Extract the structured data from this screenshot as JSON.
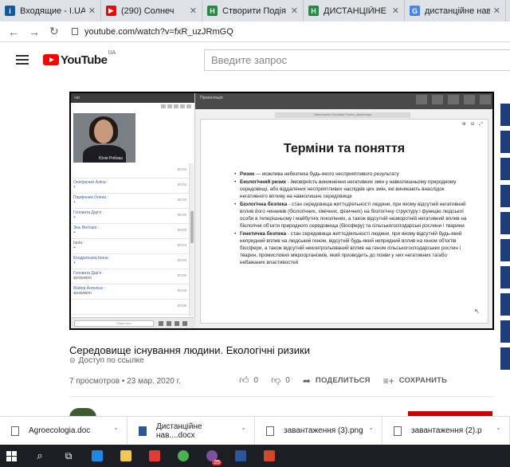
{
  "browser": {
    "tabs": [
      {
        "label": "Входящие - I.UA",
        "icon": "mail-icon",
        "color": "#0b5ba8",
        "glyph": "i"
      },
      {
        "label": "(290) Солнеч",
        "icon": "youtube-icon",
        "color": "#ff0000",
        "glyph": "▶"
      },
      {
        "label": "Створити Подія",
        "icon": "shield-icon",
        "color": "#1e8e3e",
        "glyph": "H"
      },
      {
        "label": "ДИСТАНЦІЙНЕ Н",
        "icon": "shield-icon",
        "color": "#1e8e3e",
        "glyph": "H"
      },
      {
        "label": "дистанційне нав",
        "icon": "google-icon",
        "color": "#4285f4",
        "glyph": "G"
      }
    ],
    "url": "youtube.com/watch?v=fxR_uzJRmGQ"
  },
  "youtube": {
    "logo_text": "YouTube",
    "region": "UA",
    "search_placeholder": "Введите запрос"
  },
  "conference": {
    "left_header": "чат",
    "presenter_name": "Юлія Рябова",
    "messages": [
      {
        "who": "",
        "body": "",
        "time": "00:03"
      },
      {
        "who": "Онопрієнко Аліна :",
        "body": "+",
        "time": "00:03"
      },
      {
        "who": "Парфенюк Олена :",
        "body": "+",
        "time": "00:03"
      },
      {
        "who": "Головата Дар'я :",
        "body": "+",
        "time": "00:03"
      },
      {
        "who": "Зінь Вікторія :",
        "body": "+",
        "time": "00:03"
      },
      {
        "who": "Ianta :",
        "body": "+",
        "time": "00:04"
      },
      {
        "who": "Кондратьєва Ірина :",
        "body": "+",
        "time": "00:04"
      },
      {
        "who": "Головата Дар'я :",
        "body": "зрозуміло",
        "time": "00:06"
      },
      {
        "who": "Майор Ангеліна :",
        "body": "зрозуміло",
        "time": "00:09"
      },
      {
        "who": "",
        "body": "",
        "time": "00:09"
      }
    ],
    "input_placeholder": "Надіслати",
    "right_header": "Презентація",
    "doc_bar": "Завантажена Програма Рішень_презентація"
  },
  "slide": {
    "title": "Терміни та поняття",
    "items": [
      {
        "term": "Ризик",
        "text": " — можлива небезпека будь-якого несприятливого результату"
      },
      {
        "term": "Екологічний ризик",
        "text": " - ймовірність виникнення негативних змін у навколишньому природному середовищі, або віддалених несприятливих наслідків цих змін, які виникають внаслідок негативного впливу на навколишнє середовище"
      },
      {
        "term": "Біологічна безпека",
        "text": " - стан середовища життєдіяльності людини, при якому відсутній негативний вплив його чинників (біологічних, хімічних, фізичних) на біологічну структуру і функцію людської особи в теперішньому і майбутніх поколіннях, а також відсутній незворотній негативний вплив на біологічні об'єкти природного середовища (біосферу) та сільськогосподарські рослини і тварини"
      },
      {
        "term": "Генетична безпека",
        "text": " - стан середовища життєдіяльності людини, при якому відсутній будь-який непридний вплив на людський геном, відсутній будь-який непридний вплив на геном об'єктів біосфери, а також відсутній неконтрольований вплив на геном сільськогосподарських рослин і тварин, промислових мікроорганізмів, який призводить до появи у них негативних та/або небажаних властивостей"
      }
    ]
  },
  "video": {
    "title": "Середовище існування людини. Екологічні ризики",
    "access": "Доступ по ссылке",
    "stats": "7 просмотров • 23 мар. 2020 г.",
    "likes": "0",
    "dislikes": "0",
    "share_label": "ПОДЕЛИТЬСЯ",
    "save_label": "СОХРАНИТЬ"
  },
  "downloads": [
    {
      "name": "Agroecologia.doc",
      "type": "doc"
    },
    {
      "name": "Дистанційне нав....docx",
      "type": "word"
    },
    {
      "name": "завантаження (3).png",
      "type": "png"
    },
    {
      "name": "завантаження (2).p",
      "type": "png"
    }
  ],
  "taskbar": {
    "apps": [
      {
        "name": "start-icon",
        "color": "#ffffff"
      },
      {
        "name": "search-icon",
        "color": "#ffffff"
      },
      {
        "name": "task-view-icon",
        "color": "#ffffff"
      },
      {
        "name": "edge-icon",
        "color": "#1e88e5"
      },
      {
        "name": "explorer-icon",
        "color": "#f2c94c"
      },
      {
        "name": "store-icon",
        "color": "#e53935"
      },
      {
        "name": "chrome-icon",
        "color": "#4caf50"
      },
      {
        "name": "viber-icon",
        "color": "#7b519d"
      },
      {
        "name": "word-icon",
        "color": "#2b579a"
      },
      {
        "name": "powerpoint-icon",
        "color": "#d24726"
      }
    ],
    "viber_badge": "25"
  }
}
